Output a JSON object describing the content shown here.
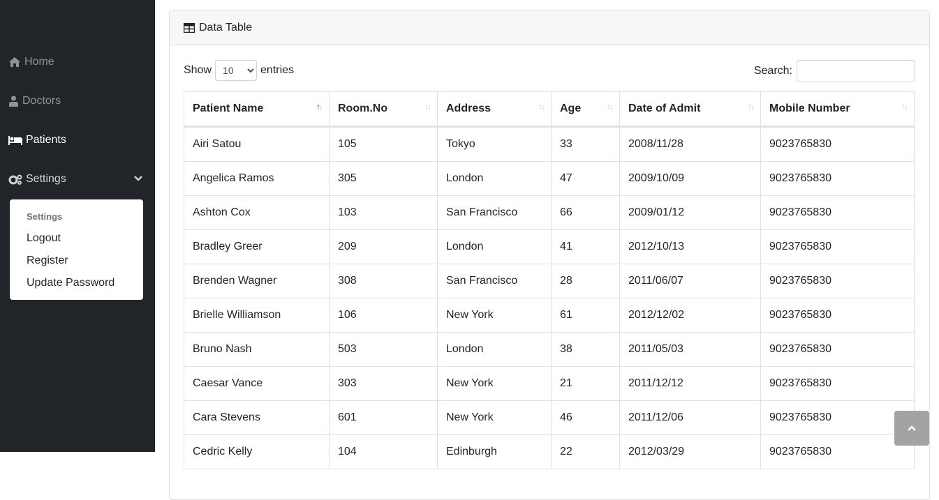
{
  "sidebar": {
    "items": [
      {
        "label": "Home",
        "icon": "home-icon"
      },
      {
        "label": "Doctors",
        "icon": "user-md-icon"
      },
      {
        "label": "Patients",
        "icon": "bed-icon"
      },
      {
        "label": "Settings",
        "icon": "gears-icon"
      }
    ],
    "submenu": {
      "header": "Settings",
      "items": [
        "Logout",
        "Register",
        "Update Password"
      ]
    }
  },
  "card": {
    "title": "Data Table",
    "title_icon": "table-icon",
    "length": {
      "prefix": "Show",
      "value": "10",
      "suffix": "entries"
    },
    "search": {
      "label": "Search:",
      "value": ""
    }
  },
  "table": {
    "headers": [
      "Patient Name",
      "Room.No",
      "Address",
      "Age",
      "Date of Admit",
      "Mobile Number"
    ],
    "rows": [
      [
        "Airi Satou",
        "105",
        "Tokyo",
        "33",
        "2008/11/28",
        "9023765830"
      ],
      [
        "Angelica Ramos",
        "305",
        "London",
        "47",
        "2009/10/09",
        "9023765830"
      ],
      [
        "Ashton Cox",
        "103",
        "San Francisco",
        "66",
        "2009/01/12",
        "9023765830"
      ],
      [
        "Bradley Greer",
        "209",
        "London",
        "41",
        "2012/10/13",
        "9023765830"
      ],
      [
        "Brenden Wagner",
        "308",
        "San Francisco",
        "28",
        "2011/06/07",
        "9023765830"
      ],
      [
        "Brielle Williamson",
        "106",
        "New York",
        "61",
        "2012/12/02",
        "9023765830"
      ],
      [
        "Bruno Nash",
        "503",
        "London",
        "38",
        "2011/05/03",
        "9023765830"
      ],
      [
        "Caesar Vance",
        "303",
        "New York",
        "21",
        "2011/12/12",
        "9023765830"
      ],
      [
        "Cara Stevens",
        "601",
        "New York",
        "46",
        "2011/12/06",
        "9023765830"
      ],
      [
        "Cedric Kelly",
        "104",
        "Edinburgh",
        "22",
        "2012/03/29",
        "9023765830"
      ]
    ]
  },
  "colors": {
    "sidebar_bg": "#212529",
    "header_bg": "#f7f7f7",
    "scroll_button": "#a3a3a3"
  }
}
